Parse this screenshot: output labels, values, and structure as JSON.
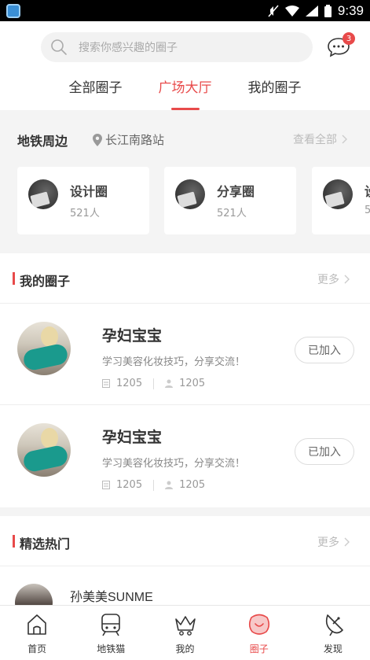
{
  "status": {
    "time": "9:39"
  },
  "header": {
    "search_placeholder": "搜索你感兴趣的圈子",
    "message_badge": "3",
    "tabs": [
      {
        "label": "全部圈子",
        "active": false
      },
      {
        "label": "广场大厅",
        "active": true
      },
      {
        "label": "我的圈子",
        "active": false
      }
    ]
  },
  "metro": {
    "title": "地铁周边",
    "location": "长江南路站",
    "view_all": "查看全部",
    "cards": [
      {
        "name": "设计圈",
        "count": "521人"
      },
      {
        "name": "分享圈",
        "count": "521人"
      },
      {
        "name": "设",
        "count": "5"
      }
    ]
  },
  "my_circles": {
    "title": "我的圈子",
    "more": "更多",
    "rows": [
      {
        "title": "孕妇宝宝",
        "desc": "学习美容化妆技巧，分享交流！",
        "posts": "1205",
        "members": "1205",
        "button": "已加入"
      },
      {
        "title": "孕妇宝宝",
        "desc": "学习美容化妆技巧，分享交流！",
        "posts": "1205",
        "members": "1205",
        "button": "已加入"
      }
    ]
  },
  "featured": {
    "title": "精选热门",
    "more": "更多",
    "first_name": "孙美美SUNME"
  },
  "bottom_nav": [
    {
      "label": "首页",
      "icon": "home-icon",
      "active": false
    },
    {
      "label": "地铁猫",
      "icon": "metro-icon",
      "active": false
    },
    {
      "label": "我的",
      "icon": "crown-icon",
      "active": false
    },
    {
      "label": "圈子",
      "icon": "circle-icon",
      "active": true
    },
    {
      "label": "发现",
      "icon": "discover-icon",
      "active": false
    }
  ],
  "colors": {
    "accent": "#e84a4a",
    "background": "#f4f4f4"
  }
}
